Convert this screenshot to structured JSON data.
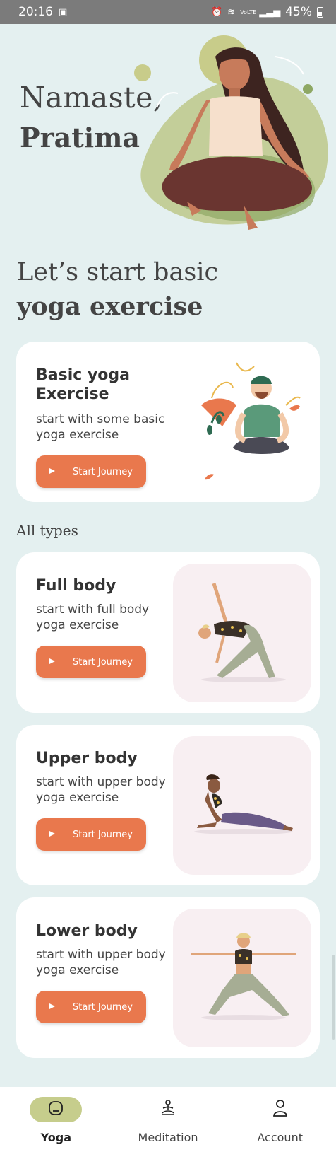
{
  "status_bar": {
    "time": "20:16",
    "icons": [
      "image-icon",
      "alarm-icon",
      "wifi-icon",
      "volte-icon",
      "signal-icon"
    ],
    "volte": "VoLTE",
    "battery": "45%"
  },
  "greeting": {
    "line1": "Namaste,",
    "name": "Pratima"
  },
  "section": {
    "title_line1": "Let’s start basic",
    "title_line2": "yoga exercise"
  },
  "featured": {
    "title": "Basic yoga Exercise",
    "description": "start with some basic yoga exercise",
    "button": "Start Journey"
  },
  "all_types_label": "All types",
  "cards": [
    {
      "title": "Full body",
      "description": "start with full body yoga exercise",
      "button": "Start Journey"
    },
    {
      "title": "Upper body",
      "description": "start with upper body yoga exercise",
      "button": "Start Journey"
    },
    {
      "title": "Lower body",
      "description": "start with upper body yoga exercise",
      "button": "Start Journey"
    }
  ],
  "nav": {
    "items": [
      {
        "label": "Yoga",
        "icon": "yoga-mat-icon",
        "active": true
      },
      {
        "label": "Meditation",
        "icon": "meditation-icon",
        "active": false
      },
      {
        "label": "Account",
        "icon": "person-icon",
        "active": false
      }
    ]
  },
  "colors": {
    "background": "#e4f0f0",
    "accent": "#e9784d",
    "nav_active": "#c6cd8c",
    "pose_bg": "#f8eff2"
  }
}
